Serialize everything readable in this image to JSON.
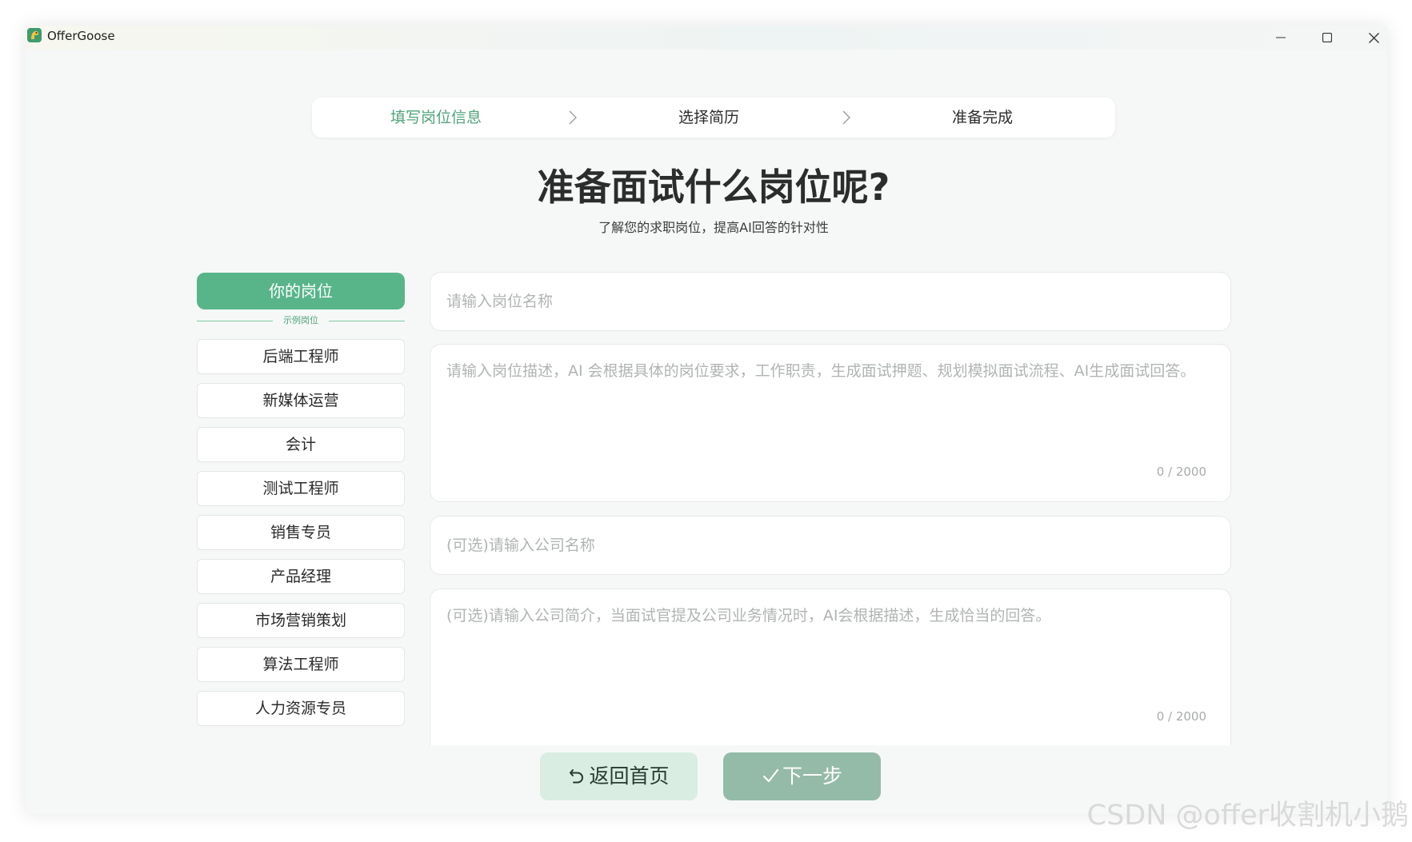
{
  "window": {
    "title": "OfferGoose",
    "minimize_icon": "minimize-icon",
    "maximize_icon": "maximize-icon",
    "close_icon": "close-icon"
  },
  "steps": [
    {
      "label": "填写岗位信息",
      "active": true
    },
    {
      "label": "选择简历",
      "active": false
    },
    {
      "label": "准备完成",
      "active": false
    }
  ],
  "page": {
    "title": "准备面试什么岗位呢?",
    "subtitle": "了解您的求职岗位，提高AI回答的针对性"
  },
  "sidebar": {
    "your_position_label": "你的岗位",
    "examples_label": "示例岗位",
    "examples": [
      "后端工程师",
      "新媒体运营",
      "会计",
      "测试工程师",
      "销售专员",
      "产品经理",
      "市场营销策划",
      "算法工程师",
      "人力资源专员"
    ]
  },
  "form": {
    "job_name": {
      "value": "",
      "placeholder": "请输入岗位名称"
    },
    "job_desc": {
      "value": "",
      "placeholder": "请输入岗位描述，AI 会根据具体的岗位要求，工作职责，生成面试押题、规划模拟面试流程、AI生成面试回答。",
      "counter": "0 / 2000"
    },
    "company_name": {
      "value": "",
      "placeholder": "(可选)请输入公司名称"
    },
    "company_intro": {
      "value": "",
      "placeholder": "(可选)请输入公司简介，当面试官提及公司业务情况时，AI会根据描述，生成恰当的回答。",
      "counter": "0 / 2000"
    }
  },
  "buttons": {
    "home_label": "返回首页",
    "home_icon": "undo-arrow-icon",
    "next_label": "下一步",
    "next_icon": "check-icon"
  },
  "colors": {
    "accent": "#58b58a",
    "accent_text": "#4fa37b",
    "next_button": "#94bba8",
    "home_button": "#d9ede3"
  },
  "watermark": "CSDN @offer收割机小鹅"
}
